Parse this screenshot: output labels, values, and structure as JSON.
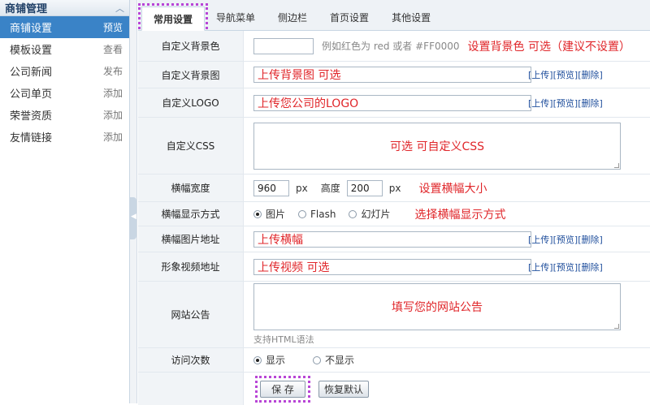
{
  "sidebar": {
    "title": "商铺管理",
    "items": [
      {
        "label": "商铺设置",
        "action": "预览"
      },
      {
        "label": "模板设置",
        "action": "查看"
      },
      {
        "label": "公司新闻",
        "action": "发布"
      },
      {
        "label": "公司单页",
        "action": "添加"
      },
      {
        "label": "荣誉资质",
        "action": "添加"
      },
      {
        "label": "友情链接",
        "action": "添加"
      }
    ]
  },
  "tabs": [
    "常用设置",
    "导航菜单",
    "侧边栏",
    "首页设置",
    "其他设置"
  ],
  "links": {
    "upload": "[上传]",
    "preview": "[预览]",
    "delete": "[删除]"
  },
  "form": {
    "bg_color": {
      "label": "自定义背景色",
      "hint": "例如红色为 red 或者 #FF0000",
      "note": "设置背景色 可选（建议不设置）"
    },
    "bg_image": {
      "label": "自定义背景图",
      "value": "上传背景图 可选"
    },
    "logo": {
      "label": "自定义LOGO",
      "value": "上传您公司的LOGO"
    },
    "css": {
      "label": "自定义CSS",
      "value": "可选 可自定义CSS"
    },
    "banner_size": {
      "label": "横幅宽度",
      "width": "960",
      "unit": "px",
      "height_label": "高度",
      "height": "200",
      "height_unit": "px",
      "note": "设置横幅大小"
    },
    "banner_mode": {
      "label": "横幅显示方式",
      "options": [
        "图片",
        "Flash",
        "幻灯片"
      ],
      "note": "选择横幅显示方式"
    },
    "banner_url": {
      "label": "横幅图片地址",
      "value": "上传横幅"
    },
    "video": {
      "label": "形象视频地址",
      "value": "上传视频 可选"
    },
    "notice": {
      "label": "网站公告",
      "value": "填写您的网站公告",
      "hint": "支持HTML语法"
    },
    "visits": {
      "label": "访问次数",
      "options": [
        "显示",
        "不显示"
      ]
    }
  },
  "buttons": {
    "save": "保 存",
    "reset": "恢复默认"
  }
}
